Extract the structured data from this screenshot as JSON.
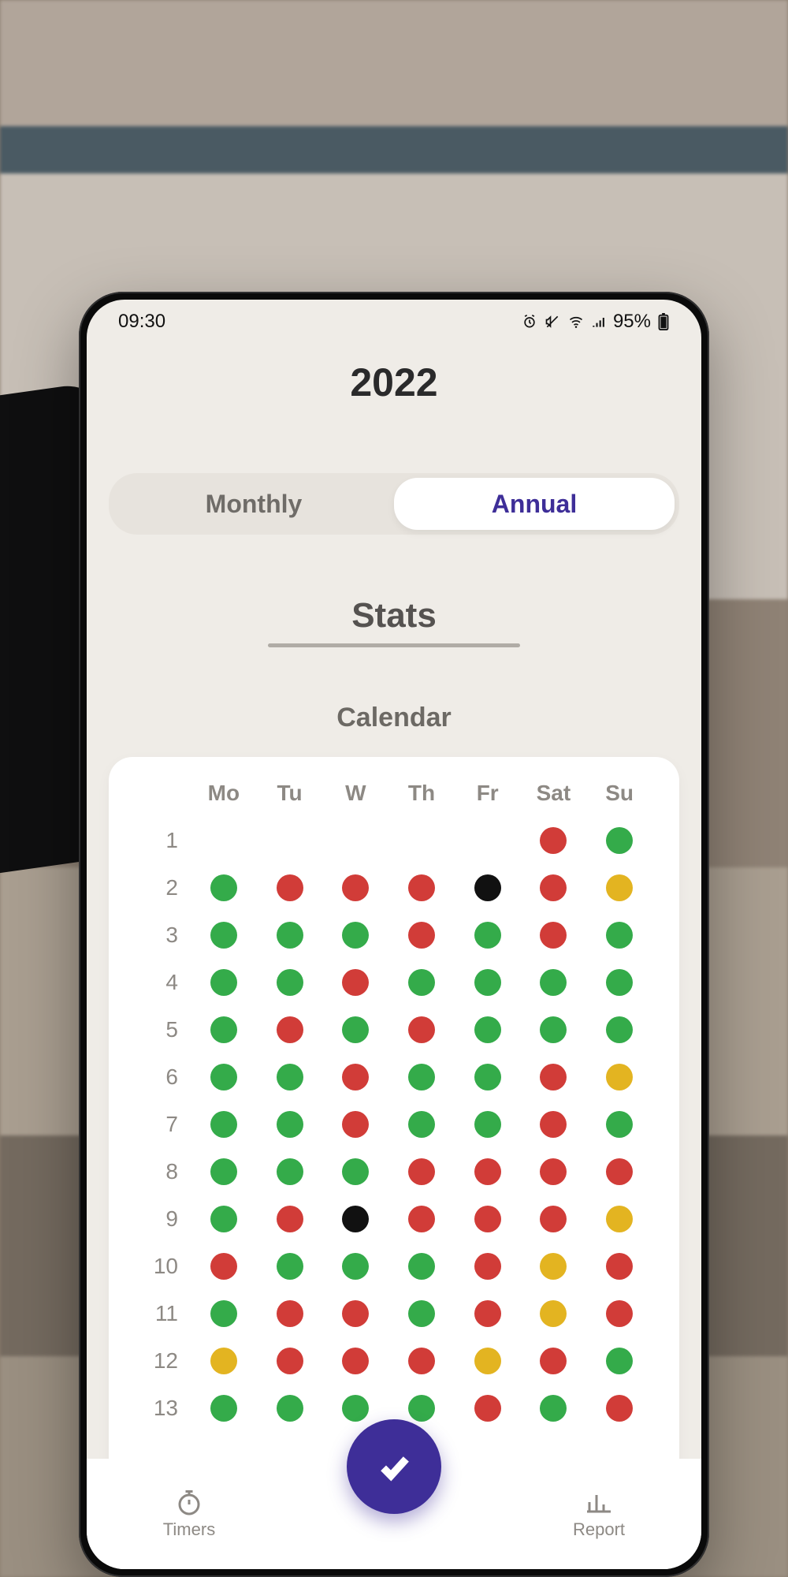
{
  "statusbar": {
    "time": "09:30",
    "battery": "95%"
  },
  "header": {
    "year": "2022"
  },
  "tabs": {
    "monthly": "Monthly",
    "annual": "Annual",
    "active": "annual"
  },
  "sections": {
    "stats": "Stats",
    "calendar": "Calendar"
  },
  "calendar": {
    "weekdays": [
      "Mo",
      "Tu",
      "W",
      "Th",
      "Fr",
      "Sat",
      "Su"
    ],
    "rows": [
      {
        "wk": "1",
        "cells": [
          "",
          "",
          "",
          "",
          "",
          "r",
          "g"
        ]
      },
      {
        "wk": "2",
        "cells": [
          "g",
          "r",
          "r",
          "r",
          "k",
          "r",
          "y"
        ]
      },
      {
        "wk": "3",
        "cells": [
          "g",
          "g",
          "g",
          "r",
          "g",
          "r",
          "g"
        ]
      },
      {
        "wk": "4",
        "cells": [
          "g",
          "g",
          "r",
          "g",
          "g",
          "g",
          "g"
        ]
      },
      {
        "wk": "5",
        "cells": [
          "g",
          "r",
          "g",
          "r",
          "g",
          "g",
          "g"
        ]
      },
      {
        "wk": "6",
        "cells": [
          "g",
          "g",
          "r",
          "g",
          "g",
          "r",
          "y"
        ]
      },
      {
        "wk": "7",
        "cells": [
          "g",
          "g",
          "r",
          "g",
          "g",
          "r",
          "g"
        ]
      },
      {
        "wk": "8",
        "cells": [
          "g",
          "g",
          "g",
          "r",
          "r",
          "r",
          "r"
        ]
      },
      {
        "wk": "9",
        "cells": [
          "g",
          "r",
          "k",
          "r",
          "r",
          "r",
          "y"
        ]
      },
      {
        "wk": "10",
        "cells": [
          "r",
          "g",
          "g",
          "g",
          "r",
          "y",
          "r"
        ]
      },
      {
        "wk": "11",
        "cells": [
          "g",
          "r",
          "r",
          "g",
          "r",
          "y",
          "r"
        ]
      },
      {
        "wk": "12",
        "cells": [
          "y",
          "r",
          "r",
          "r",
          "y",
          "r",
          "g"
        ]
      },
      {
        "wk": "13",
        "cells": [
          "g",
          "g",
          "g",
          "g",
          "r",
          "g",
          "r"
        ]
      }
    ],
    "colorLegend": {
      "g": "green",
      "r": "red",
      "y": "yellow",
      "k": "black",
      "": "empty"
    }
  },
  "nav": {
    "timers": "Timers",
    "report": "Report"
  }
}
